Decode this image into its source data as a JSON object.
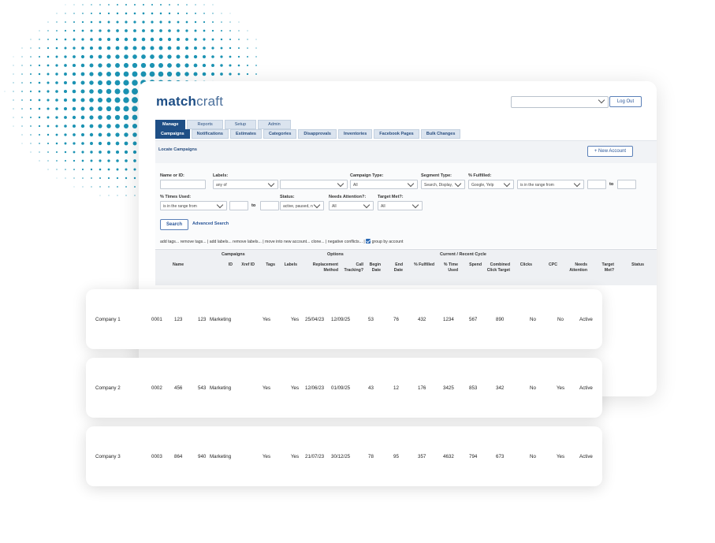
{
  "header": {
    "logo_part1": "match",
    "logo_part2": "craft",
    "account_select_value": "",
    "logout_label": "Log Out"
  },
  "tabs_top": [
    "Manage",
    "Reports",
    "Setup",
    "Admin"
  ],
  "tabs_sub": [
    "Campaigns",
    "Notifications",
    "Estimates",
    "Categories",
    "Disapprovals",
    "Inventories",
    "Facebook Pages",
    "Bulk Changes"
  ],
  "locate": {
    "title": "Locate Campaigns",
    "new_account_label": "+ New Account"
  },
  "form": {
    "name_label": "Name or ID:",
    "name_value": "",
    "labels_label": "Labels:",
    "labels_mode": "any of",
    "labels_value": "",
    "campaign_type_label": "Campaign Type:",
    "campaign_type_value": "All",
    "segment_type_label": "Segment Type:",
    "segment_type_value": "Search, Display,",
    "fulfilled_label": "% Fulfilled:",
    "fulfilled_source": "Google, Yelp",
    "fulfilled_range": "is in the range from",
    "to_label": "to",
    "times_used_label": "% Times Used:",
    "times_used_range": "is in the range from",
    "status_label": "Status:",
    "status_value": "active, paused, n",
    "needs_attention_label": "Needs Attention?:",
    "needs_attention_value": "All",
    "target_met_label": "Target Met?:",
    "target_met_value": "All",
    "search_label": "Search",
    "advanced_label": "Advanced Search"
  },
  "bulk_links": "add tags...   remove tags...   |  add labels...   remove labels...   |  move into new account...   clone...   |  negative conflicts...  |",
  "group_by_account_label": "group by account",
  "table": {
    "groups": [
      "Campaigns",
      "Options",
      "Current / Recent Cycle"
    ],
    "columns": [
      "Name",
      "ID",
      "Xref ID",
      "Tags",
      "Labels",
      "Replacement Method",
      "Call Tracking?",
      "Begin Date",
      "End Date",
      "% Fulfilled",
      "% Time Used",
      "Spend",
      "Combined Click Target",
      "Clicks",
      "CPC",
      "Needs Attention",
      "Target Met?",
      "Status"
    ],
    "rows": [
      [
        "Company 1",
        "0001",
        "123",
        "123",
        "Marketing",
        "Yes",
        "Yes",
        "25/04/23",
        "12/09/25",
        "53",
        "76",
        "432",
        "1234",
        "567",
        "890",
        "No",
        "No",
        "Active"
      ],
      [
        "Company 2",
        "0002",
        "456",
        "543",
        "Marketing",
        "Yes",
        "Yes",
        "12/06/23",
        "01/09/25",
        "43",
        "12",
        "176",
        "3425",
        "853",
        "342",
        "No",
        "Yes",
        "Active"
      ],
      [
        "Company 3",
        "0003",
        "864",
        "940",
        "Marketing",
        "Yes",
        "Yes",
        "21/07/23",
        "30/12/25",
        "78",
        "95",
        "357",
        "4632",
        "794",
        "673",
        "No",
        "Yes",
        "Active"
      ]
    ]
  },
  "colors": {
    "brand": "#1f4f86",
    "dots": "#1b93b3"
  }
}
